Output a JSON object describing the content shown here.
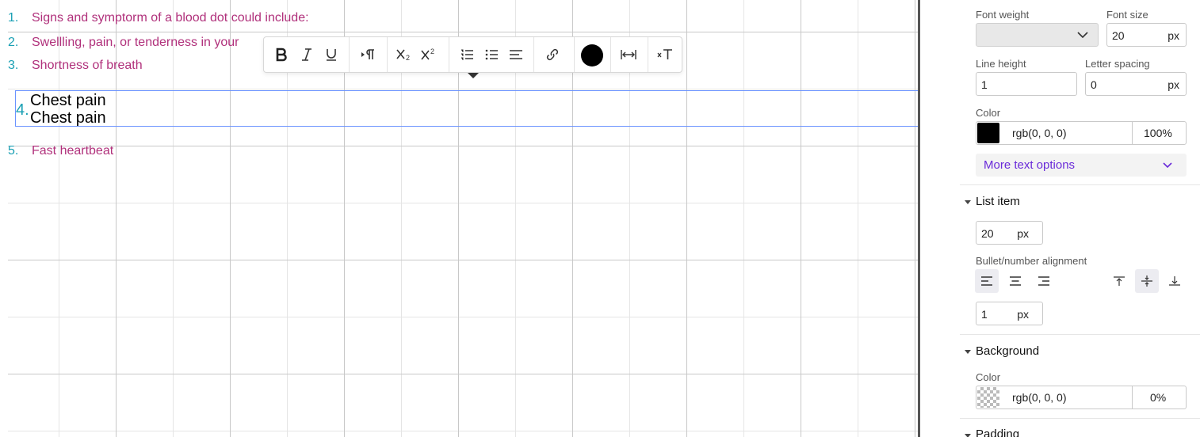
{
  "editor": {
    "list": [
      {
        "num": "1.",
        "text": "Signs and symptorm of a blood dot could include:"
      },
      {
        "num": "2.",
        "text": "Swellling, pain, or tenderness in your"
      },
      {
        "num": "3.",
        "text": "Shortness of breath"
      },
      {
        "num": "5.",
        "text": "Fast heartbeat"
      }
    ],
    "selected": {
      "num": "4.",
      "line1": "Chest pain",
      "line2": "Chest pain"
    }
  },
  "toolbar": {
    "buttons": [
      "bold-icon",
      "italic-icon",
      "underline-icon",
      "paragraph-direction-icon",
      "subscript-icon",
      "superscript-icon",
      "ordered-list-icon",
      "unordered-list-icon",
      "align-icon",
      "link-icon",
      "text-color-icon",
      "letter-spacing-icon",
      "clear-format-icon"
    ],
    "text_color": "#000000"
  },
  "panel": {
    "typography": {
      "font_weight_label": "Font weight",
      "font_weight_value": "",
      "font_size_label": "Font size",
      "font_size_value": "20",
      "font_size_unit": "px",
      "line_height_label": "Line height",
      "line_height_value": "1",
      "letter_spacing_label": "Letter spacing",
      "letter_spacing_value": "0",
      "letter_spacing_unit": "px",
      "color_label": "Color",
      "color_value": "rgb(0, 0, 0)",
      "color_opacity": "100%",
      "more_label": "More text options"
    },
    "list_item": {
      "title": "List item",
      "size_value": "20",
      "size_unit": "px",
      "alignment_label": "Bullet/number alignment",
      "gap_value": "1",
      "gap_unit": "px"
    },
    "background": {
      "title": "Background",
      "color_label": "Color",
      "color_value": "rgb(0, 0, 0)",
      "color_opacity": "0%"
    },
    "padding": {
      "title": "Padding"
    }
  },
  "colors": {
    "accent": "#6a2bd9",
    "list_text": "#b0307b",
    "list_number": "#1aa0b4",
    "selection": "#6b93ff"
  }
}
